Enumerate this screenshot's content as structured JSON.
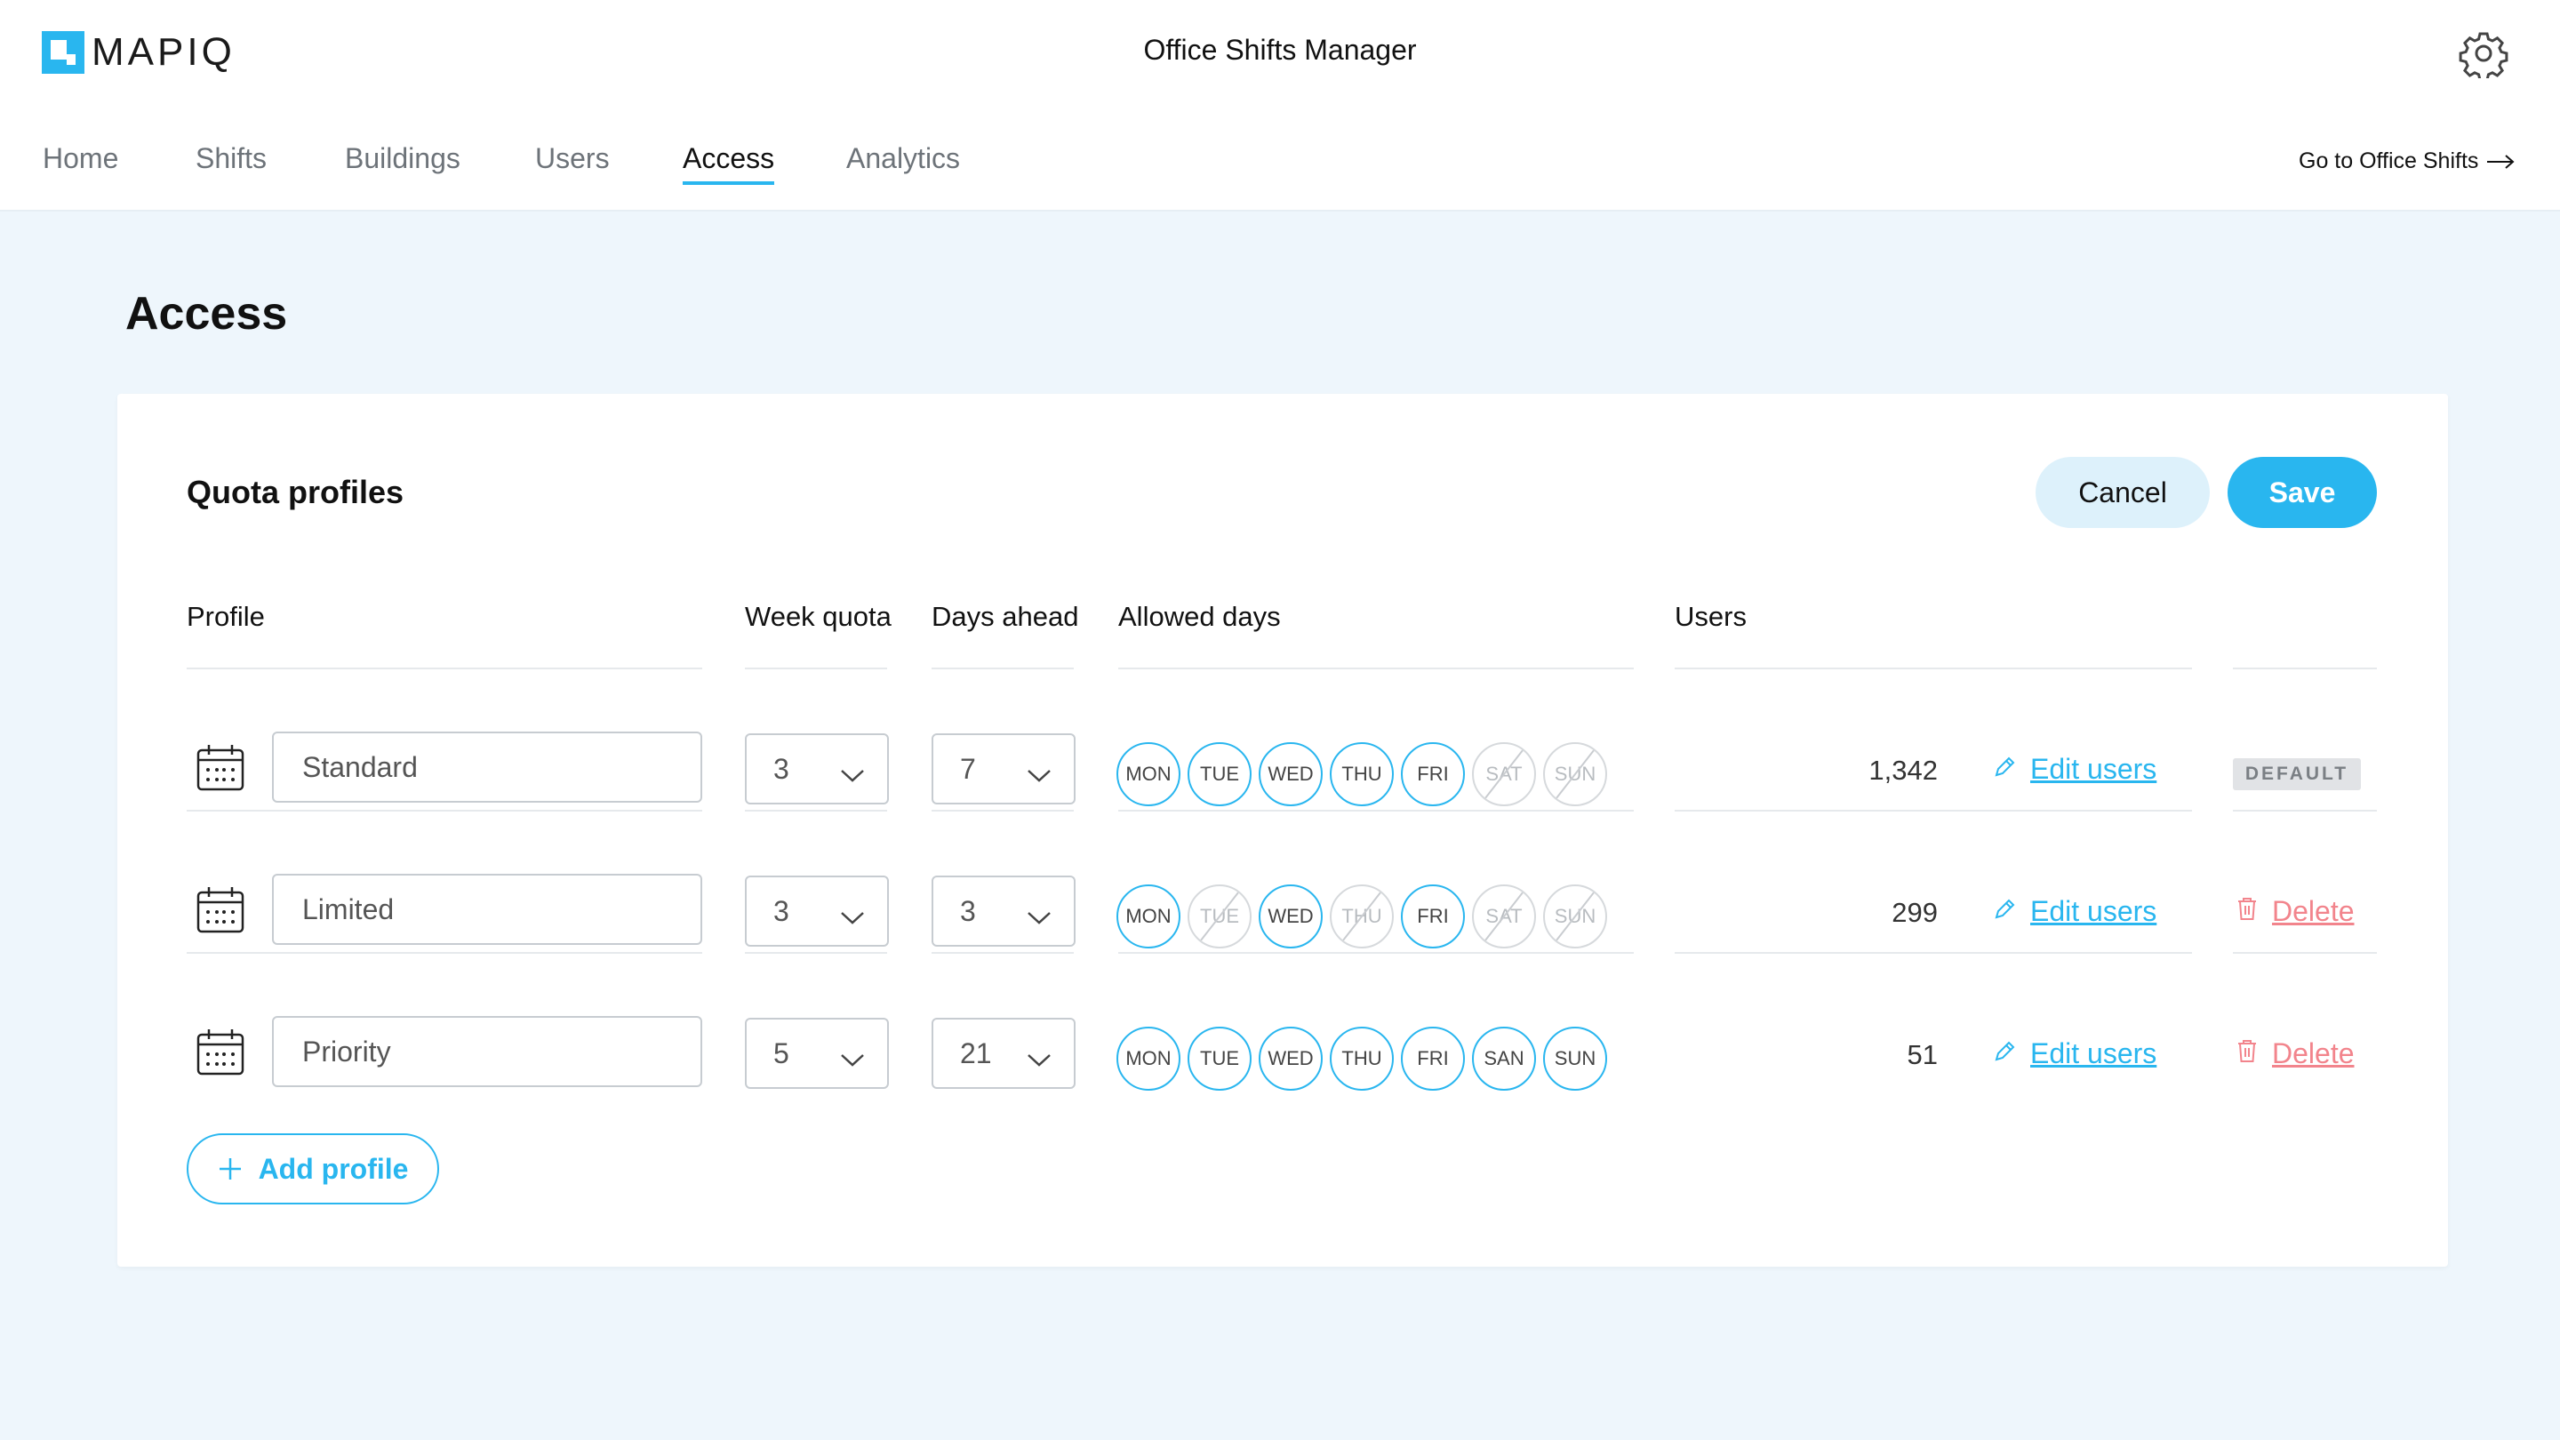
{
  "app": {
    "logo_text": "MAPIQ",
    "title": "Office Shifts Manager"
  },
  "nav": {
    "items": [
      "Home",
      "Shifts",
      "Buildings",
      "Users",
      "Access",
      "Analytics"
    ],
    "active": "Access",
    "goto_label": "Go to Office Shifts"
  },
  "page": {
    "title": "Access"
  },
  "quota": {
    "title": "Quota profiles",
    "cancel_label": "Cancel",
    "save_label": "Save",
    "columns": {
      "profile": "Profile",
      "week_quota": "Week quota",
      "days_ahead": "Days ahead",
      "allowed_days": "Allowed days",
      "users": "Users"
    },
    "edit_users_label": "Edit users",
    "delete_label": "Delete",
    "default_badge": "DEFAULT",
    "add_profile_label": "Add profile",
    "profiles": [
      {
        "name": "Standard",
        "week_quota": "3",
        "days_ahead": "7",
        "days": [
          {
            "label": "MON",
            "on": true
          },
          {
            "label": "TUE",
            "on": true
          },
          {
            "label": "WED",
            "on": true
          },
          {
            "label": "THU",
            "on": true
          },
          {
            "label": "FRI",
            "on": true
          },
          {
            "label": "SAT",
            "on": false
          },
          {
            "label": "SUN",
            "on": false
          }
        ],
        "users": "1,342",
        "is_default": true
      },
      {
        "name": "Limited",
        "week_quota": "3",
        "days_ahead": "3",
        "days": [
          {
            "label": "MON",
            "on": true
          },
          {
            "label": "TUE",
            "on": false
          },
          {
            "label": "WED",
            "on": true
          },
          {
            "label": "THU",
            "on": false
          },
          {
            "label": "FRI",
            "on": true
          },
          {
            "label": "SAT",
            "on": false
          },
          {
            "label": "SUN",
            "on": false
          }
        ],
        "users": "299",
        "is_default": false
      },
      {
        "name": "Priority",
        "week_quota": "5",
        "days_ahead": "21",
        "days": [
          {
            "label": "MON",
            "on": true
          },
          {
            "label": "TUE",
            "on": true
          },
          {
            "label": "WED",
            "on": true
          },
          {
            "label": "THU",
            "on": true
          },
          {
            "label": "FRI",
            "on": true
          },
          {
            "label": "SAN",
            "on": true
          },
          {
            "label": "SUN",
            "on": true
          }
        ],
        "users": "51",
        "is_default": false
      }
    ]
  },
  "colors": {
    "accent": "#29b6ef",
    "danger": "#f2848c",
    "background": "#eef6fc"
  }
}
